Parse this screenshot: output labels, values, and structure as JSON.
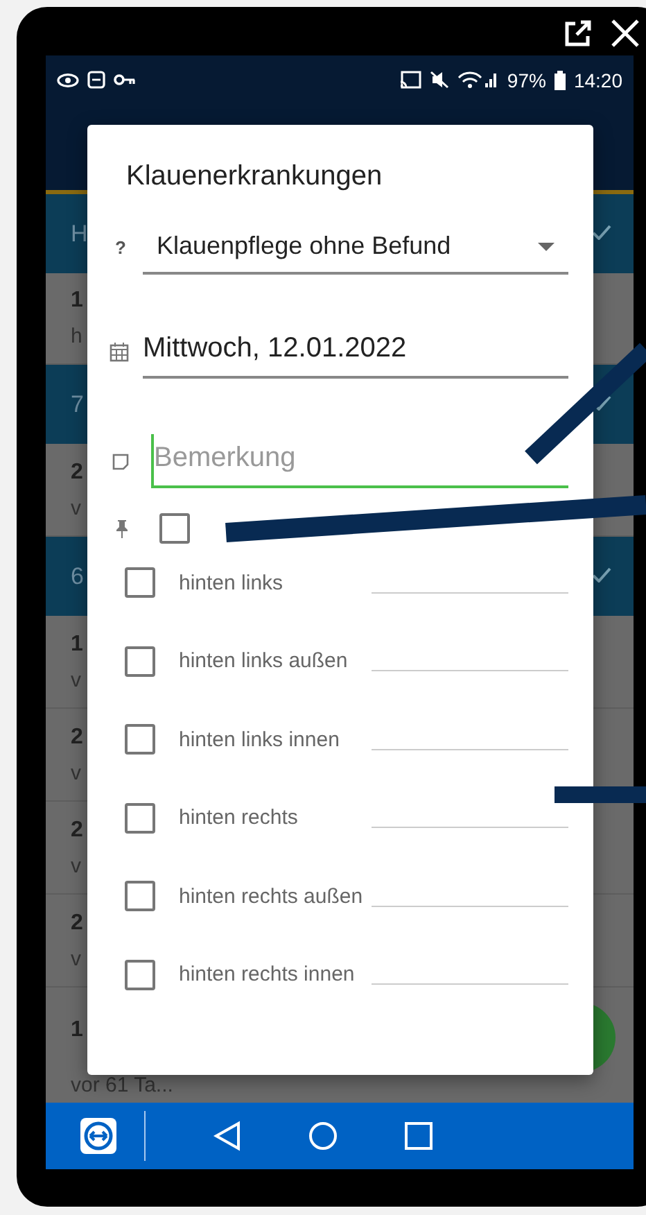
{
  "status_bar": {
    "battery": "97%",
    "time": "14:20"
  },
  "background_rows": [
    {
      "kind": "header",
      "text": "H"
    },
    {
      "kind": "item",
      "line1": "1",
      "line2": "h"
    },
    {
      "kind": "header",
      "text": "7"
    },
    {
      "kind": "item",
      "line1": "2",
      "line2": "v"
    },
    {
      "kind": "header",
      "text": "6"
    },
    {
      "kind": "item",
      "line1": "1",
      "line2": "v"
    },
    {
      "kind": "item",
      "line1": "2",
      "line2": "v"
    },
    {
      "kind": "item",
      "line1": "2",
      "line2": "v"
    },
    {
      "kind": "item",
      "line1": "2",
      "line2": "v"
    },
    {
      "kind": "item",
      "line1": "1",
      "line2": "vor 61 Ta..."
    }
  ],
  "dialog": {
    "title": "Klauenerkrankungen",
    "select": {
      "icon": "?",
      "value": "Klauenpflege ohne Befund"
    },
    "date": {
      "value": "Mittwoch, 12.01.2022"
    },
    "remark": {
      "placeholder": "Bemerkung",
      "focused": true
    },
    "pin_checkbox": {
      "checked": false
    },
    "options": [
      {
        "label": "hinten links",
        "checked": false
      },
      {
        "label": "hinten links außen",
        "checked": false
      },
      {
        "label": "hinten links innen",
        "checked": false
      },
      {
        "label": "hinten rechts",
        "checked": false
      },
      {
        "label": "hinten rechts außen",
        "checked": false
      },
      {
        "label": "hinten rechts innen",
        "checked": false
      }
    ]
  }
}
